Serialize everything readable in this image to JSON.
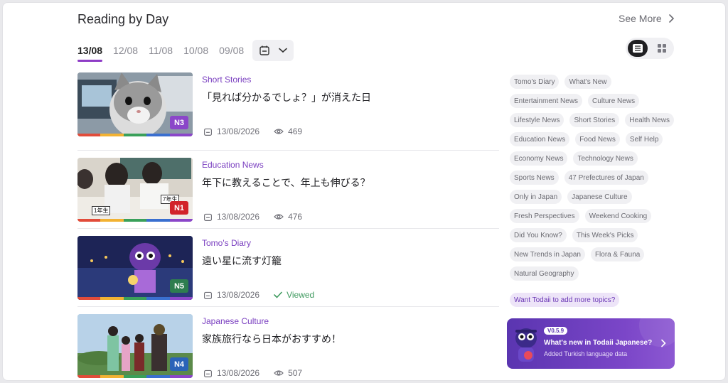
{
  "header": {
    "title": "Reading by Day",
    "see_more": "See More"
  },
  "date_tabs": [
    "13/08",
    "12/08",
    "11/08",
    "10/08",
    "09/08"
  ],
  "articles": [
    {
      "category": "Short Stories",
      "title": "「見れば分かるでしょ？」が消えた日",
      "level": "N3",
      "level_color": "#8b46c9",
      "date": "13/08/2026",
      "views": "469",
      "viewed": false
    },
    {
      "category": "Education News",
      "title": "年下に教えることで、年上も伸びる？",
      "level": "N1",
      "level_color": "#d2232a",
      "date": "13/08/2026",
      "views": "476",
      "viewed": false,
      "thumb_labels": [
        "1年生",
        "7年生"
      ]
    },
    {
      "category": "Tomo's Diary",
      "title": "遠い星に流す灯籠",
      "level": "N5",
      "level_color": "#2e7d4f",
      "date": "13/08/2026",
      "views": "",
      "viewed": true,
      "viewed_label": "Viewed"
    },
    {
      "category": "Japanese Culture",
      "title": "家族旅行なら日本がおすすめ！",
      "level": "N4",
      "level_color": "#2b63b8",
      "date": "13/08/2026",
      "views": "507",
      "viewed": false
    }
  ],
  "tags": [
    "Tomo's Diary",
    "What's New",
    "Entertainment News",
    "Culture News",
    "Lifestyle News",
    "Short Stories",
    "Health News",
    "Education News",
    "Food News",
    "Self Help",
    "Economy News",
    "Technology News",
    "Sports News",
    "47 Prefectures of Japan",
    "Only in Japan",
    "Japanese Culture",
    "Fresh Perspectives",
    "Weekend Cooking",
    "Did You Know?",
    "This Week's Picks",
    "New Trends in Japan",
    "Flora & Fauna",
    "Natural Geography"
  ],
  "more_topics": "Want Todaii to add more topics?",
  "promo": {
    "version": "V0.5.9",
    "title": "What's new in Todaii Japanese?",
    "subtitle": "Added Turkish language data"
  },
  "colors": {
    "accent": "#8e3cc6",
    "category": "#7a3fc0",
    "viewed": "#3f9a5f"
  }
}
